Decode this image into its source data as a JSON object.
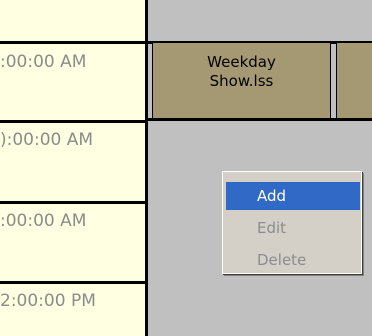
{
  "times": [
    ":00:00 AM",
    "):00:00 AM",
    ":00:00 AM",
    "2:00:00 PM"
  ],
  "event": {
    "title_line1": "Weekday",
    "title_line2": "Show.lss"
  },
  "context_menu": {
    "items": [
      {
        "label": "Add",
        "state": "highlighted"
      },
      {
        "label": "Edit",
        "state": "disabled"
      },
      {
        "label": "Delete",
        "state": "disabled"
      }
    ]
  }
}
